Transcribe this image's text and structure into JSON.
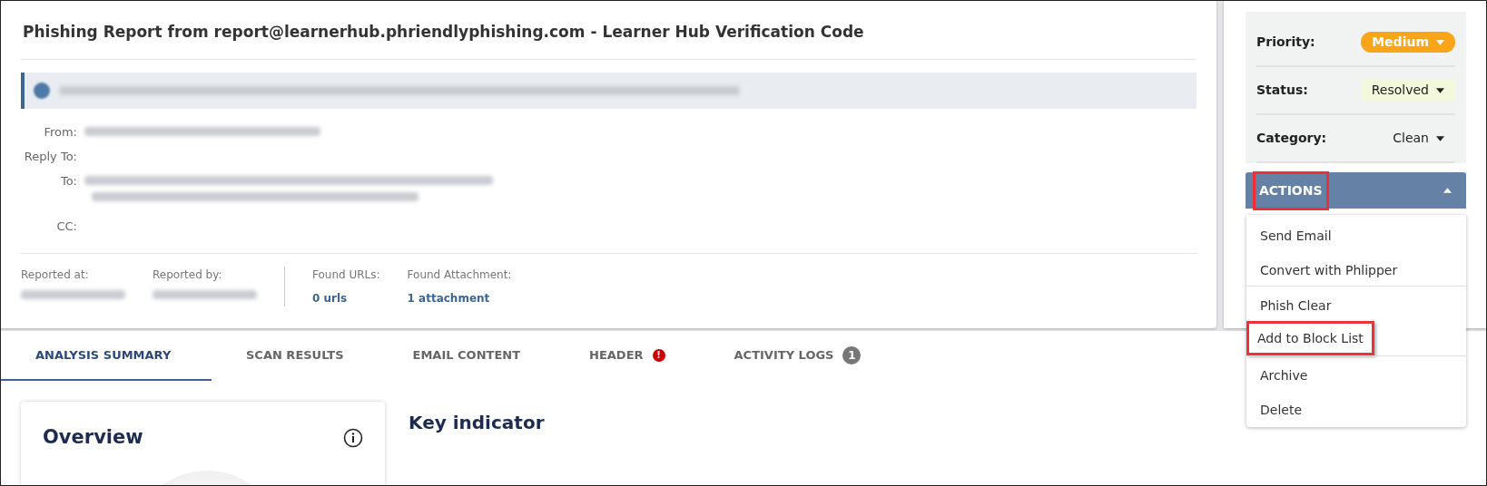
{
  "report": {
    "title": "Phishing Report from report@learnerhub.phriendlyphishing.com - Learner Hub Verification Code",
    "notice": {
      "kind": "redacted"
    },
    "fields": [
      {
        "label": "From:",
        "kind": "redacted"
      },
      {
        "label": "Reply To:",
        "kind": "empty"
      },
      {
        "label": "To:",
        "kind": "redacted_multiline"
      },
      {
        "label": "CC:",
        "kind": "empty"
      }
    ],
    "meta_groups": [
      [
        {
          "label": "Reported at:",
          "kind": "redacted"
        },
        {
          "label": "Reported by:",
          "kind": "redacted"
        }
      ],
      [
        {
          "label": "Found URLs:",
          "kind": "link",
          "value": "0 urls"
        },
        {
          "label": "Found Attachment:",
          "kind": "link",
          "value": "1 attachment"
        }
      ]
    ]
  },
  "properties": [
    {
      "label": "Priority:",
      "value": "Medium",
      "kind": "pill"
    },
    {
      "label": "Status:",
      "value": "Resolved",
      "kind": "tinted"
    },
    {
      "label": "Category:",
      "value": "Clean",
      "kind": "plain"
    }
  ],
  "actions": {
    "label": "ACTIONS",
    "expanded": true,
    "highlighted": true,
    "groups": [
      [
        {
          "label": "Send Email",
          "highlighted": false
        },
        {
          "label": "Convert with Phlipper",
          "highlighted": false
        }
      ],
      [
        {
          "label": "Phish Clear",
          "highlighted": false
        },
        {
          "label": "Add to Block List",
          "highlighted": true
        }
      ],
      [
        {
          "label": "Archive",
          "highlighted": false
        },
        {
          "label": "Delete",
          "highlighted": false
        }
      ]
    ]
  },
  "tabs": [
    {
      "label": "ANALYSIS SUMMARY",
      "selected": true
    },
    {
      "label": "SCAN RESULTS",
      "selected": false
    },
    {
      "label": "EMAIL CONTENT",
      "selected": false
    },
    {
      "label": "HEADER",
      "selected": false,
      "alert": "!"
    },
    {
      "label": "ACTIVITY LOGS",
      "selected": false,
      "count": "1"
    }
  ],
  "overview": {
    "title": "Overview"
  },
  "key_indicator": {
    "title": "Key indicator"
  }
}
